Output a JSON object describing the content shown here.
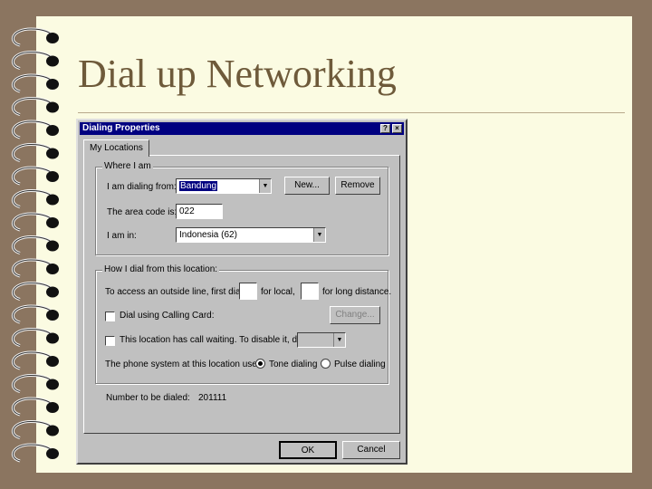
{
  "slide": {
    "title": "Dial up Networking"
  },
  "dialog": {
    "title": "Dialing Properties",
    "help_button": "?",
    "close_button": "×",
    "tab": "My Locations",
    "where_group": {
      "legend": "Where I am",
      "dialing_from_label": "I am dialing from:",
      "dialing_from_value": "Bandung",
      "new_button": "New...",
      "remove_button": "Remove",
      "area_code_label": "The area code is:",
      "area_code_value": "022",
      "country_label": "I am in:",
      "country_value": "Indonesia (62)"
    },
    "how_group": {
      "legend": "How I dial from this location:",
      "outside_line_label": "To access an outside line, first dial:",
      "local_label": "for local,",
      "long_distance_label": "for long distance.",
      "calling_card_label": "Dial using Calling Card:",
      "change_button": "Change...",
      "call_waiting_label": "This location has call waiting. To disable it, dial:",
      "phone_system_label": "The phone system at this location uses:",
      "tone_label": "Tone dialing",
      "pulse_label": "Pulse dialing"
    },
    "number_label": "Number to be dialed:",
    "number_value": "201111",
    "ok_button": "OK",
    "cancel_button": "Cancel"
  }
}
